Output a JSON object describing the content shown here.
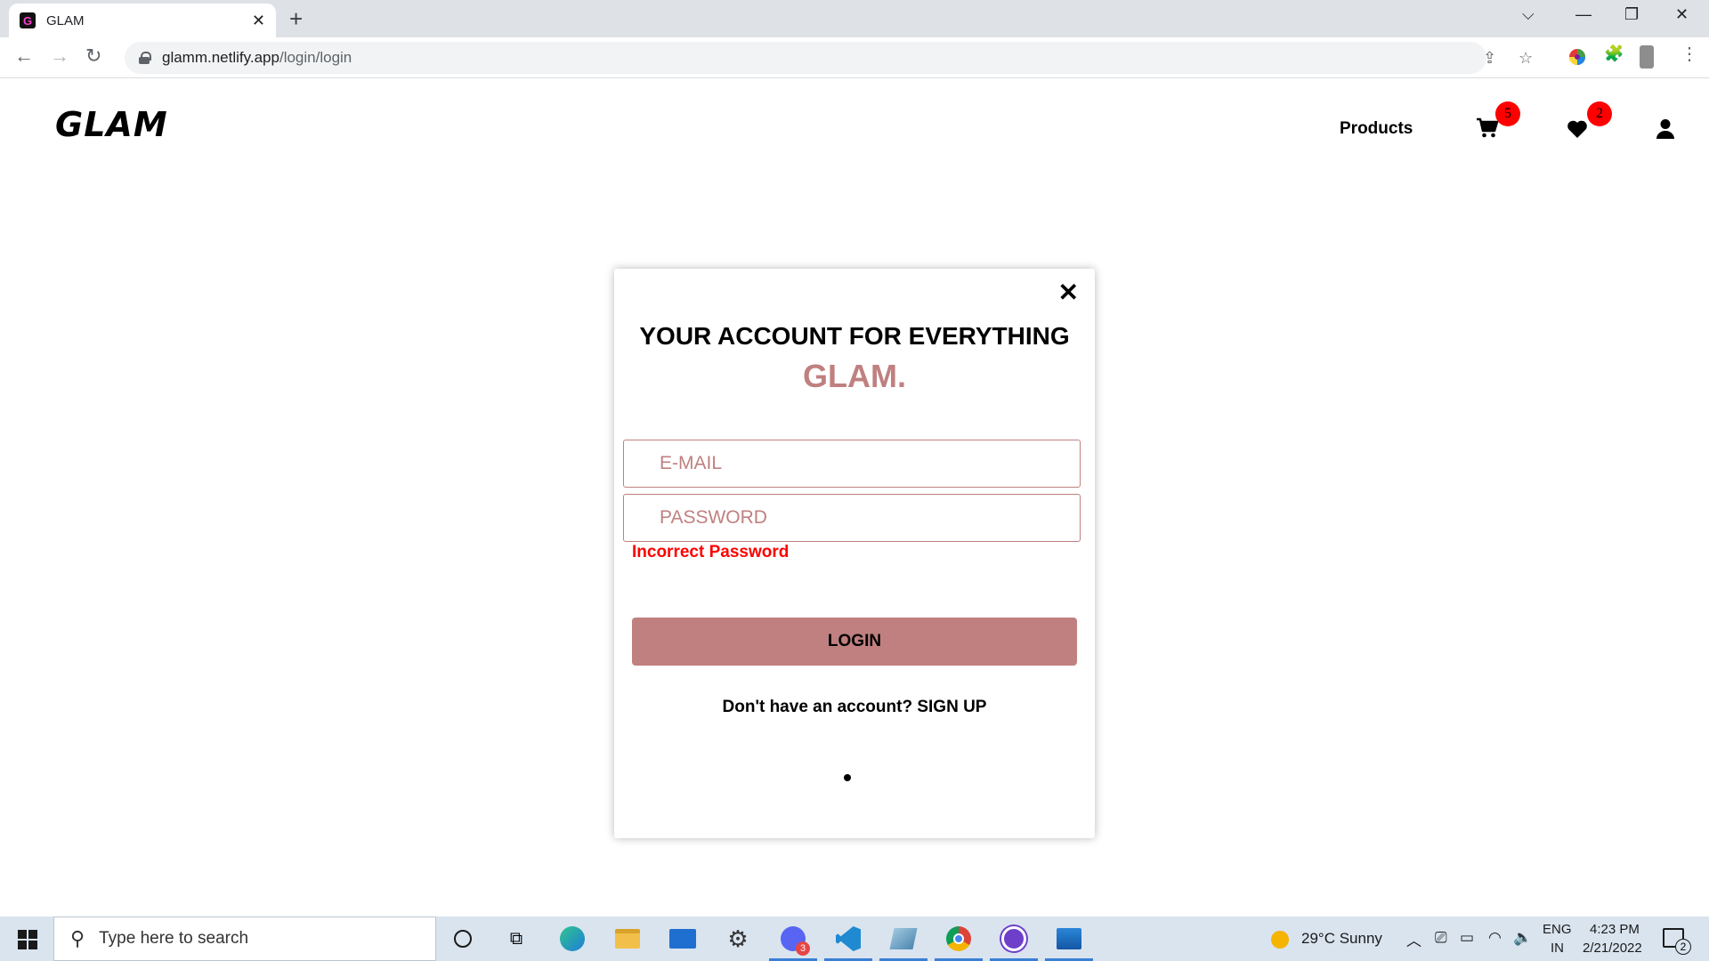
{
  "browser": {
    "tab_title": "GLAM",
    "favicon_letter": "G",
    "url_host": "glamm.netlify.app",
    "url_path": "/login/login"
  },
  "site": {
    "logo": "GLAM",
    "nav_products": "Products",
    "cart_count": "5",
    "wishlist_count": "2"
  },
  "modal": {
    "heading": "YOUR ACCOUNT FOR EVERYTHING",
    "brand": "GLAM.",
    "email_placeholder": "E-MAIL",
    "password_placeholder": "PASSWORD",
    "error": "Incorrect Password",
    "login_label": "LOGIN",
    "signup_text": "Don't have an account? SIGN UP"
  },
  "taskbar": {
    "search_placeholder": "Type here to search",
    "weather": "29°C  Sunny",
    "lang_top": "ENG",
    "lang_bottom": "IN",
    "time": "4:23 PM",
    "date": "2/21/2022",
    "notification_count": "2",
    "discord_badge": "3"
  },
  "colors": {
    "accent": "#c08080",
    "error": "#ff0000",
    "badge": "#ff0000"
  }
}
